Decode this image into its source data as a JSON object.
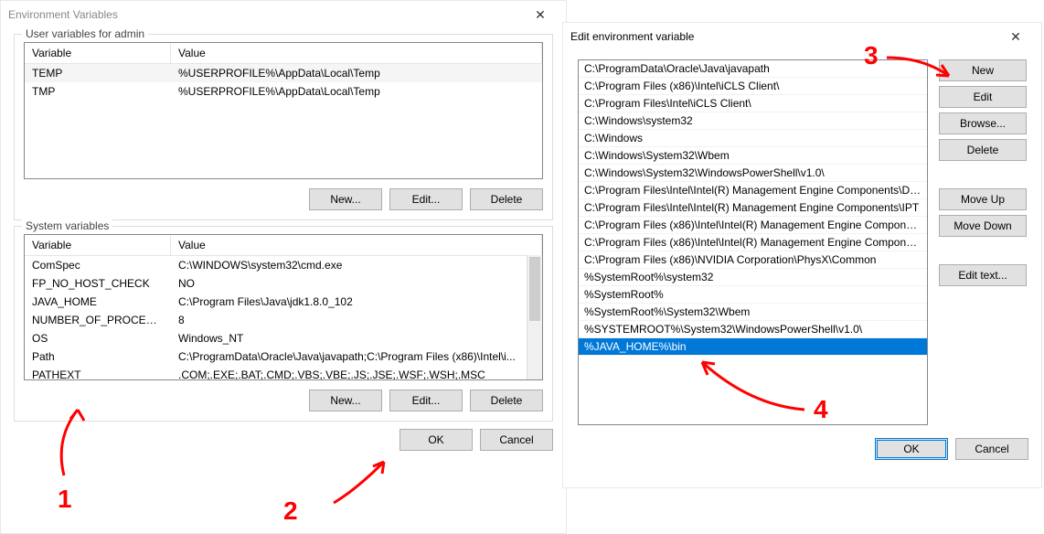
{
  "env_dialog": {
    "title": "Environment Variables",
    "user_section": {
      "legend": "User variables for admin",
      "columns": {
        "var": "Variable",
        "val": "Value"
      },
      "rows": [
        {
          "var": "TEMP",
          "val": "%USERPROFILE%\\AppData\\Local\\Temp"
        },
        {
          "var": "TMP",
          "val": "%USERPROFILE%\\AppData\\Local\\Temp"
        }
      ],
      "btn_new": "New...",
      "btn_edit": "Edit...",
      "btn_delete": "Delete"
    },
    "sys_section": {
      "legend": "System variables",
      "columns": {
        "var": "Variable",
        "val": "Value"
      },
      "rows": [
        {
          "var": "ComSpec",
          "val": "C:\\WINDOWS\\system32\\cmd.exe"
        },
        {
          "var": "FP_NO_HOST_CHECK",
          "val": "NO"
        },
        {
          "var": "JAVA_HOME",
          "val": "C:\\Program Files\\Java\\jdk1.8.0_102"
        },
        {
          "var": "NUMBER_OF_PROCESSORS",
          "val": "8"
        },
        {
          "var": "OS",
          "val": "Windows_NT"
        },
        {
          "var": "Path",
          "val": "C:\\ProgramData\\Oracle\\Java\\javapath;C:\\Program Files (x86)\\Intel\\i..."
        },
        {
          "var": "PATHEXT",
          "val": ".COM;.EXE;.BAT;.CMD;.VBS;.VBE;.JS;.JSE;.WSF;.WSH;.MSC"
        }
      ],
      "btn_new": "New...",
      "btn_edit": "Edit...",
      "btn_delete": "Delete"
    },
    "btn_ok": "OK",
    "btn_cancel": "Cancel"
  },
  "edit_dialog": {
    "title": "Edit environment variable",
    "items": [
      "C:\\ProgramData\\Oracle\\Java\\javapath",
      "C:\\Program Files (x86)\\Intel\\iCLS Client\\",
      "C:\\Program Files\\Intel\\iCLS Client\\",
      "C:\\Windows\\system32",
      "C:\\Windows",
      "C:\\Windows\\System32\\Wbem",
      "C:\\Windows\\System32\\WindowsPowerShell\\v1.0\\",
      "C:\\Program Files\\Intel\\Intel(R) Management Engine Components\\DAL",
      "C:\\Program Files\\Intel\\Intel(R) Management Engine Components\\IPT",
      "C:\\Program Files (x86)\\Intel\\Intel(R) Management Engine Component...",
      "C:\\Program Files (x86)\\Intel\\Intel(R) Management Engine Component...",
      "C:\\Program Files (x86)\\NVIDIA Corporation\\PhysX\\Common",
      "%SystemRoot%\\system32",
      "%SystemRoot%",
      "%SystemRoot%\\System32\\Wbem",
      "%SYSTEMROOT%\\System32\\WindowsPowerShell\\v1.0\\",
      "%JAVA_HOME%\\bin"
    ],
    "selected_index": 16,
    "btn_new": "New",
    "btn_edit": "Edit",
    "btn_browse": "Browse...",
    "btn_delete": "Delete",
    "btn_moveup": "Move Up",
    "btn_movedn": "Move Down",
    "btn_edittext": "Edit text...",
    "btn_ok": "OK",
    "btn_cancel": "Cancel"
  },
  "annotations": {
    "n1": "1",
    "n2": "2",
    "n3": "3",
    "n4": "4"
  }
}
